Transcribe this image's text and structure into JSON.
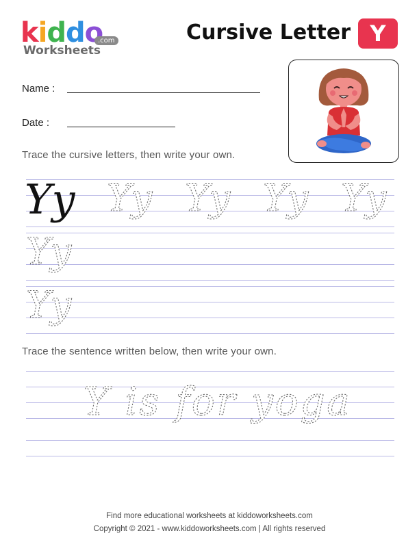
{
  "brand": {
    "logo_letters": [
      "k",
      "i",
      "d",
      "d",
      "o"
    ],
    "logo_colors": [
      "#e8344f",
      "#f5a623",
      "#3fb34f",
      "#2f8fe0",
      "#8b4fd6"
    ],
    "logo_sub": "Worksheets",
    "logo_com": ".com"
  },
  "header": {
    "title": "Cursive Letter",
    "letter": "Y",
    "accent_color": "#e8344f"
  },
  "fields": {
    "name_label": "Name :",
    "date_label": "Date :"
  },
  "illustration": {
    "icon": "girl-meditating-yoga-icon"
  },
  "section1": {
    "instruction": "Trace the cursive letters, then write your own.",
    "solid_example": "Yy",
    "trace_pairs": [
      "Yy",
      "Yy",
      "Yy",
      "Yy",
      "Yy",
      "Yy"
    ]
  },
  "section2": {
    "instruction": "Trace the sentence written below, then write your own.",
    "sentence": "Y is for yoga"
  },
  "footer": {
    "line1": "Find more educational worksheets at kiddoworksheets.com",
    "line2": "Copyright © 2021 - www.kiddoworksheets.com  |  All rights reserved"
  }
}
